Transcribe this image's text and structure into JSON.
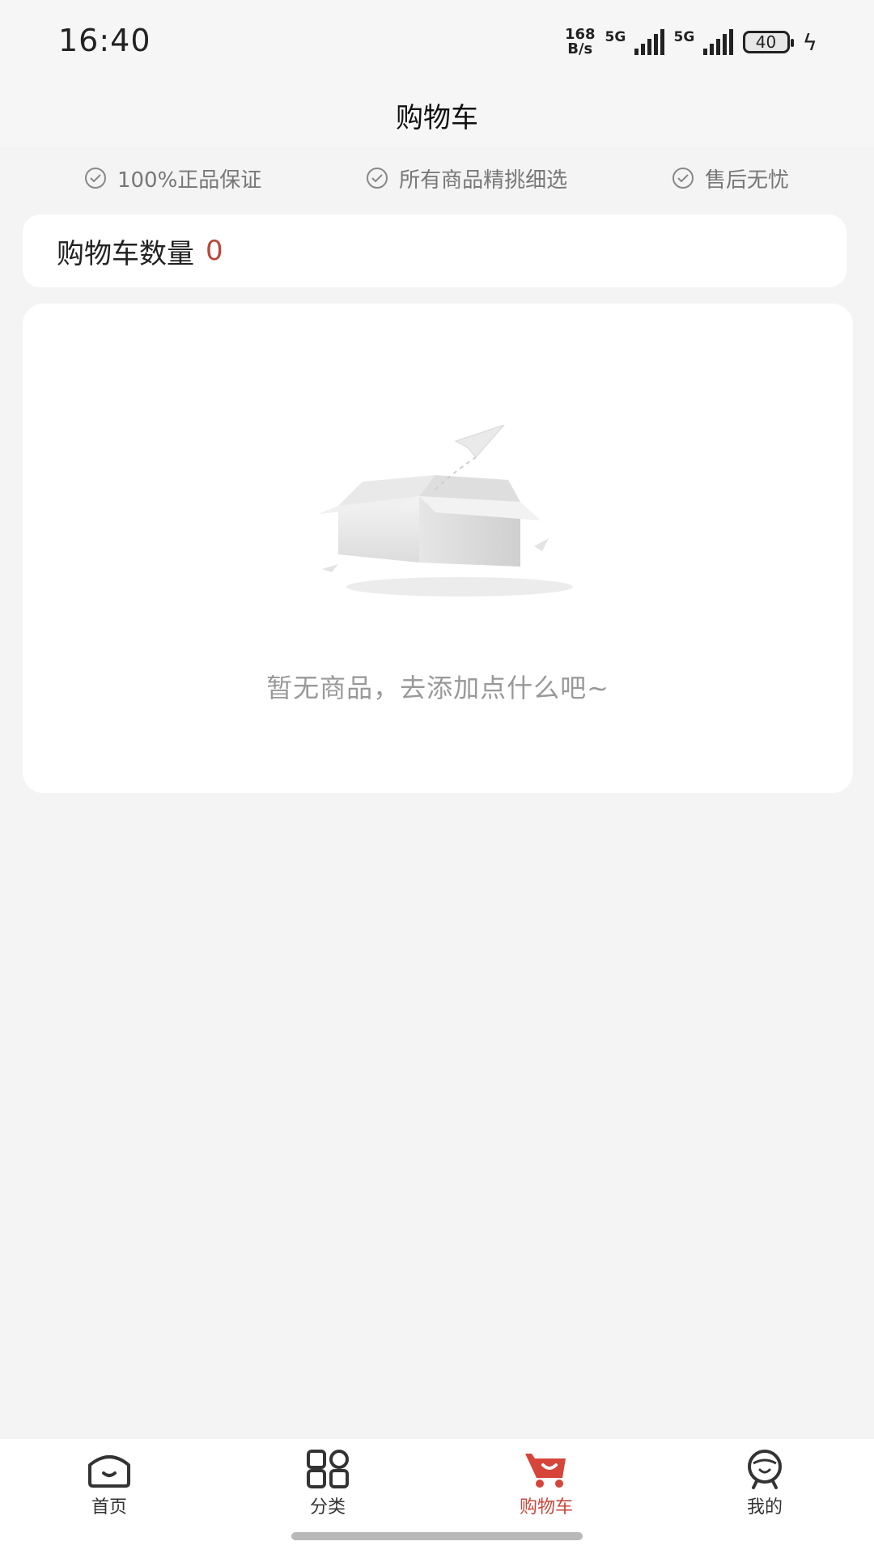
{
  "status_bar": {
    "time": "16:40",
    "net_speed_value": "168",
    "net_speed_unit": "B/s",
    "signal1_label": "5G",
    "signal2_label": "5G",
    "battery_level": "40"
  },
  "header": {
    "title": "购物车"
  },
  "guarantees": [
    {
      "label": "100%正品保证",
      "icon": "check-circle-icon"
    },
    {
      "label": "所有商品精挑细选",
      "icon": "check-circle-icon"
    },
    {
      "label": "售后无忧",
      "icon": "check-circle-icon"
    }
  ],
  "cart_count": {
    "label": "购物车数量",
    "value": "0"
  },
  "empty_state": {
    "message": "暂无商品，去添加点什么吧~",
    "illustration": "empty-box-paper-plane"
  },
  "tabbar": {
    "items": [
      {
        "label": "首页",
        "icon": "home-icon",
        "active": false
      },
      {
        "label": "分类",
        "icon": "category-grid-icon",
        "active": false
      },
      {
        "label": "购物车",
        "icon": "cart-icon",
        "active": true
      },
      {
        "label": "我的",
        "icon": "profile-icon",
        "active": false
      }
    ]
  },
  "colors": {
    "accent": "#c44a3c",
    "count_value": "#b9473b",
    "background": "#f4f4f4"
  }
}
